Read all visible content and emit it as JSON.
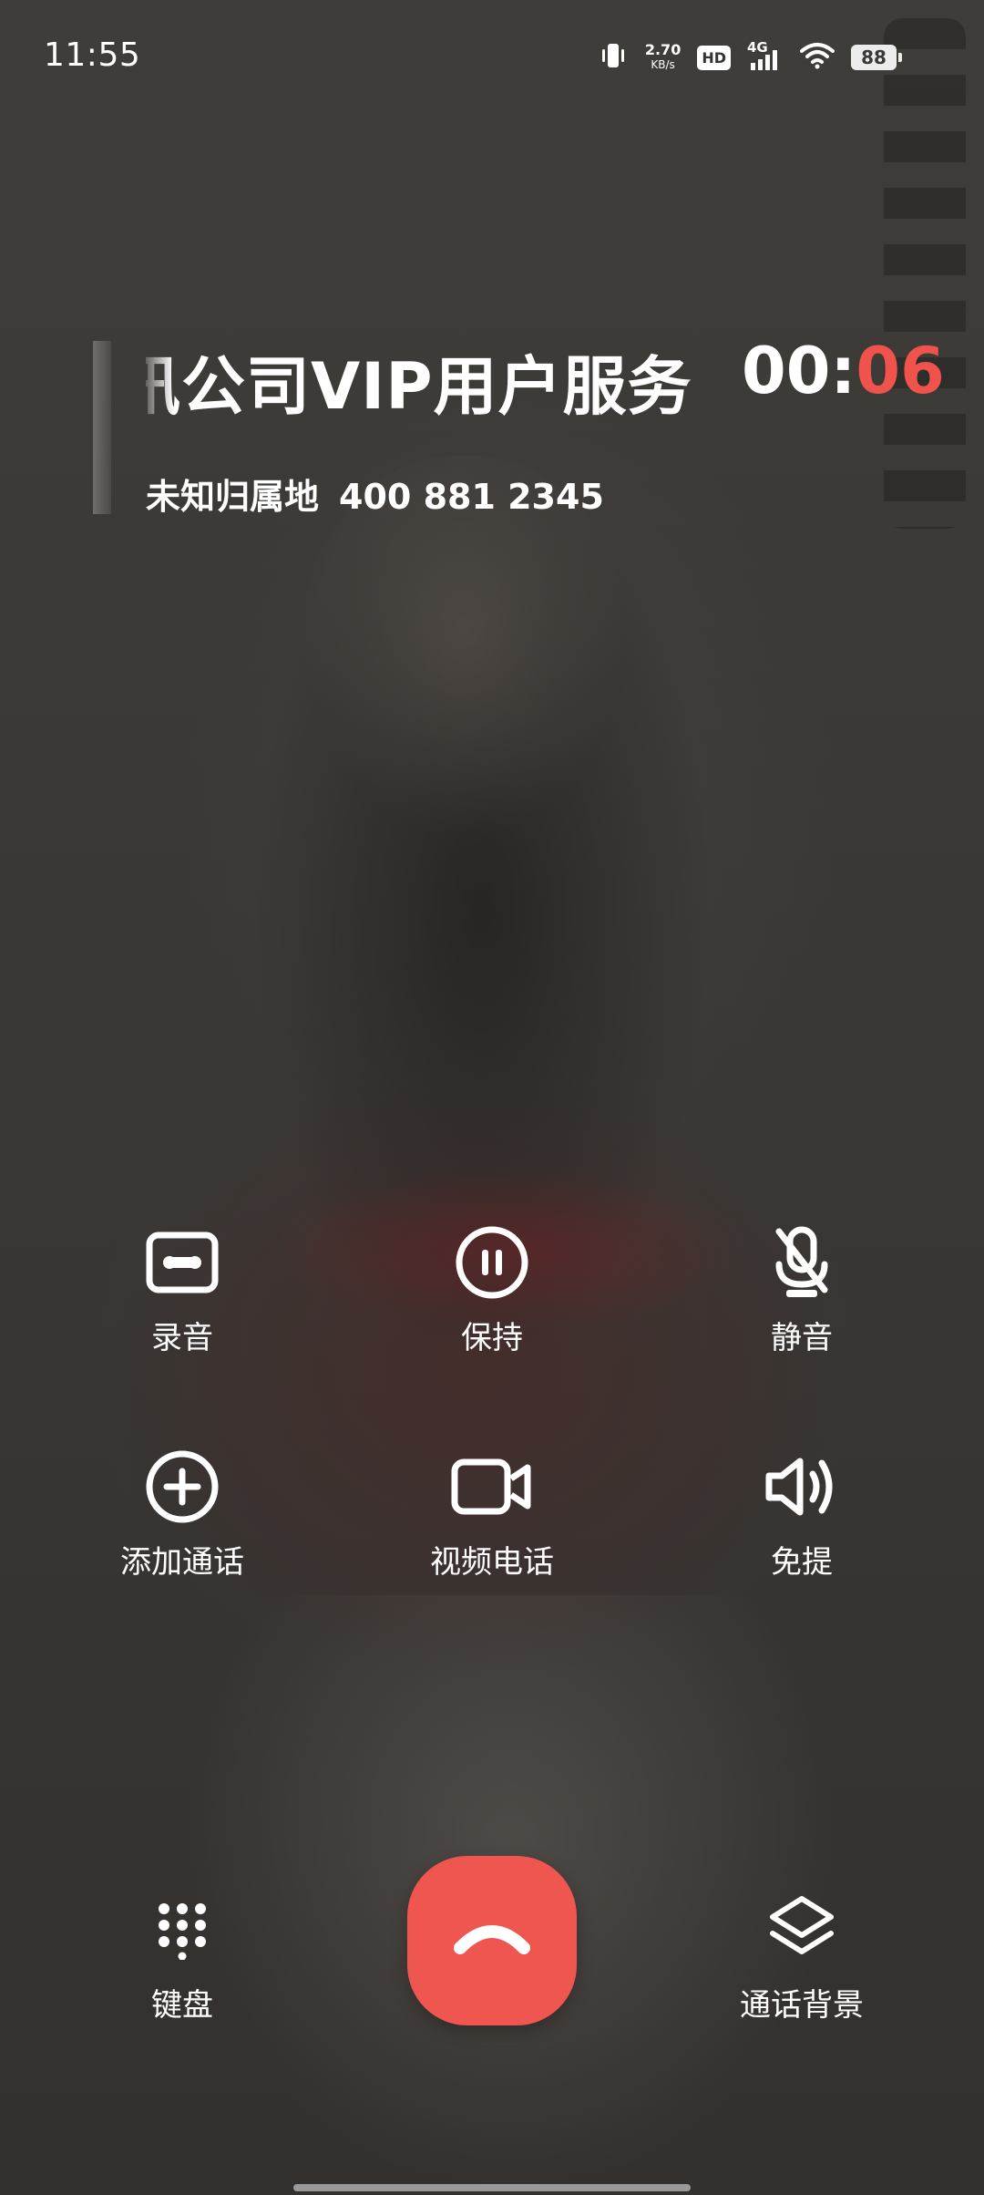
{
  "status_bar": {
    "time": "11:55",
    "net_speed_value": "2.70",
    "net_speed_unit": "KB/s",
    "hd_label": "HD",
    "network_label": "4G",
    "battery_level": "88"
  },
  "caller": {
    "name": "讯公司VIP用户服务",
    "timer_prefix": "00:",
    "timer_seconds": "06",
    "location": "未知归属地",
    "number": "400 881 2345"
  },
  "actions": {
    "record": "录音",
    "hold": "保持",
    "mute": "静音",
    "add_call": "添加通话",
    "video_call": "视频电话",
    "speaker": "免提",
    "keypad": "键盘",
    "call_background": "通话背景"
  },
  "icons": {
    "record": "cassette-icon",
    "hold": "pause-circle-icon",
    "mute": "mic-off-icon",
    "add_call": "plus-circle-icon",
    "video_call": "video-camera-icon",
    "speaker": "speaker-icon",
    "keypad": "dialpad-icon",
    "call_background": "layers-icon",
    "end_call": "hang-up-icon"
  },
  "colors": {
    "end_call": "#ef5650",
    "timer_accent": "#f0524c"
  }
}
